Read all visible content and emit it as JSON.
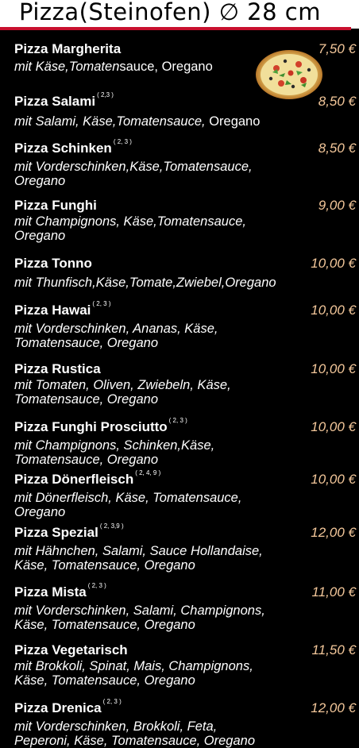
{
  "header": {
    "title": "Pizza(Steinofen) ∅ 28 cm"
  },
  "items": [
    {
      "name": "Pizza Margherita",
      "note": "",
      "price": "7,50 €",
      "desc": "mit Käse,Tomatensauce, Oregano"
    },
    {
      "name": "Pizza Salami",
      "note": "( 2,3 )",
      "price": "8,50 €",
      "desc": "mit Salami, Käse,Tomatensauce, Oregano"
    },
    {
      "name": "Pizza Schinken",
      "note": "( 2, 3 )",
      "price": "8,50 €",
      "desc": "mit Vorderschinken,Käse,Tomatensauce,\nOregano"
    },
    {
      "name": "Pizza Funghi",
      "note": "",
      "price": "9,00 €",
      "desc": "mit Champignons, Käse,Tomatensauce,\nOregano"
    },
    {
      "name": "Pizza Tonno",
      "note": "",
      "price": "10,00 €",
      "desc": "mit Thunfisch,Käse,Tomate,Zwiebel,Oregano"
    },
    {
      "name": "Pizza Hawai",
      "note": "( 2, 3 )",
      "price": "10,00 €",
      "desc": "mit Vorderschinken, Ananas, Käse,\nTomatensauce, Oregano"
    },
    {
      "name": "Pizza Rustica",
      "note": "",
      "price": "10,00 €",
      "desc": "mit Tomaten, Oliven, Zwiebeln, Käse,\nTomatensauce, Oregano"
    },
    {
      "name": "Pizza Funghi Prosciutto",
      "note": "( 2, 3 )",
      "price": "10,00 €",
      "desc": "mit Champignons, Schinken,Käse,\nTomatensauce, Oregano"
    },
    {
      "name": "Pizza Dönerfleisch",
      "note": "( 2, 4, 9 )",
      "price": "10,00 €",
      "desc": "mit Dönerfleisch, Käse, Tomatensauce,\nOregano"
    },
    {
      "name": "Pizza Spezial",
      "note": "( 2, 3,9 )",
      "price": "12,00 €",
      "desc": "mit Hähnchen, Salami, Sauce Hollandaise,\nKäse, Tomatensauce, Oregano"
    },
    {
      "name": "Pizza Mista",
      "note": "( 2, 3 )",
      "price": "11,00 €",
      "desc": "mit Vorderschinken, Salami, Champignons,\nKäse, Tomatensauce, Oregano"
    },
    {
      "name": "Pizza Vegetarisch",
      "note": "",
      "price": "11,50 €",
      "desc": "mit Brokkoli, Spinat, Mais, Champignons,\nKäse, Tomatensauce, Oregano"
    },
    {
      "name": "Pizza Drenica",
      "note": "( 2, 3 )",
      "price": "12,00 €",
      "desc": "mit Vorderschinken, Brokkoli, Feta,\nPeperoni, Käse, Tomatensauce, Oregano"
    }
  ],
  "image": {
    "name": "pizza-photo"
  }
}
